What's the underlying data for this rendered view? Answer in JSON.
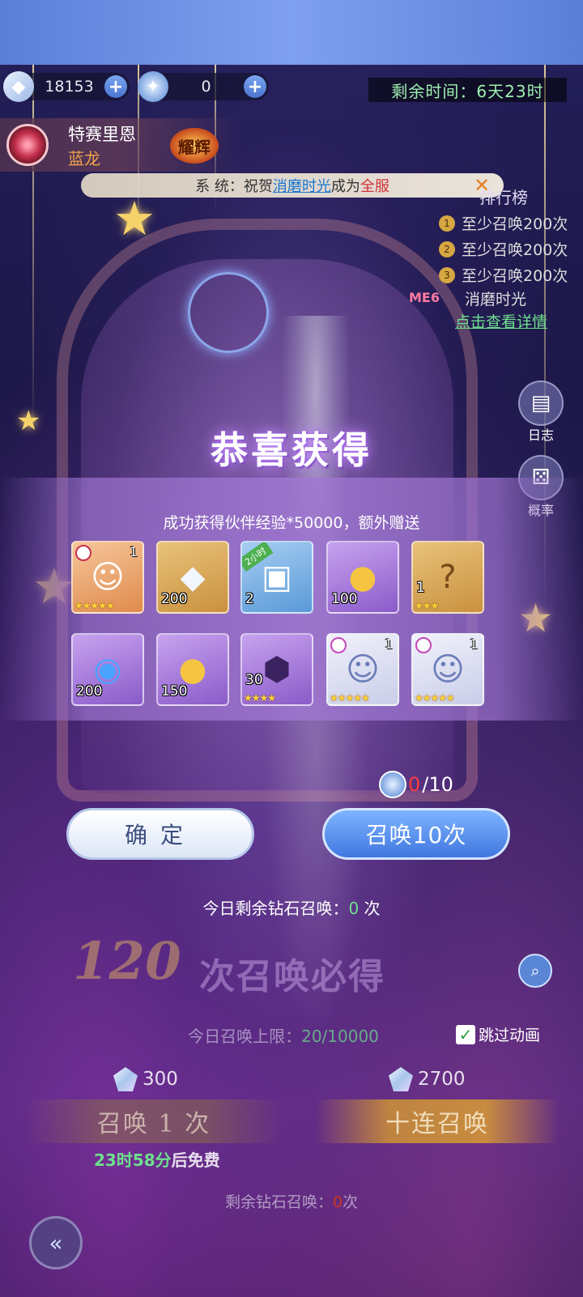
{
  "resources": [
    {
      "icon": "diamond-icon",
      "value": "18153"
    },
    {
      "icon": "summon-ticket-icon",
      "value": "0"
    }
  ],
  "timer": "剩余时间：6天23时",
  "banner": {
    "title": "特赛里恩",
    "subtitle": "蓝龙",
    "badge": "耀辉"
  },
  "system_message": {
    "prefix": "系 统：祝贺",
    "link": "消磨时光",
    "middle": "成为",
    "highlight": "全服"
  },
  "ranking": {
    "title": "排行榜",
    "items": [
      {
        "rank": "1",
        "text": "至少召唤200次"
      },
      {
        "rank": "2",
        "text": "至少召唤200次"
      },
      {
        "rank": "3",
        "text": "至少召唤200次"
      }
    ],
    "me_label": "ME6",
    "me_name": "消磨时光",
    "detail_link": "点击查看详情"
  },
  "side_buttons": [
    {
      "icon": "log-icon",
      "label": "日志"
    },
    {
      "icon": "dice-icon",
      "label": "概率"
    }
  ],
  "reward_popup": {
    "title": "恭喜获得",
    "subtitle": "成功获得伙伴经验*50000，额外赠送",
    "items_row1": [
      {
        "icon": "partner-portrait-icon",
        "count": "",
        "top": "1",
        "stars": "★★★★★",
        "rarity": "orange"
      },
      {
        "icon": "diamond-icon",
        "count": "200",
        "top": "",
        "stars": "",
        "rarity": "gold"
      },
      {
        "icon": "treasure-chest-icon",
        "count": "2",
        "top": "",
        "stars": "",
        "rarity": "blue",
        "tag": "2小时"
      },
      {
        "icon": "golden-egg-icon",
        "count": "100",
        "top": "",
        "stars": "",
        "rarity": "purple"
      },
      {
        "icon": "mystery-box-icon",
        "count": "1",
        "top": "",
        "stars": "★★★",
        "rarity": "gold"
      }
    ],
    "items_row2": [
      {
        "icon": "crystal-orb-icon",
        "count": "200",
        "top": "",
        "stars": "",
        "rarity": "purple"
      },
      {
        "icon": "golden-egg-icon",
        "count": "150",
        "top": "",
        "stars": "",
        "rarity": "purple"
      },
      {
        "icon": "shard-crystal-icon",
        "count": "30",
        "top": "",
        "stars": "★★★★",
        "rarity": "purple"
      },
      {
        "icon": "partner-portrait-icon",
        "count": "",
        "top": "1",
        "stars": "★★★★★",
        "rarity": "white"
      },
      {
        "icon": "partner-portrait-icon",
        "count": "",
        "top": "1",
        "stars": "★★★★★",
        "rarity": "white"
      }
    ],
    "ticket_current": "0",
    "ticket_total": "/10",
    "confirm_label": "确定",
    "summon10_label": "召唤10次",
    "daily_left_prefix": "今日剩余钻石召唤：",
    "daily_left_value": "0",
    "daily_left_suffix": " 次"
  },
  "background": {
    "guarantee_number": "120",
    "guarantee_text": "次召唤必得",
    "limit_prefix": "今日召唤上限：",
    "limit_value": "20/10000",
    "skip_label": "跳过动画",
    "cost_one": "300",
    "cost_ten": "2700",
    "summon_one_label": "召唤 1 次",
    "summon_ten_label": "十连召唤",
    "free_time": "23时58分",
    "free_suffix": "后免费",
    "remain_prefix": "剩余钻石召唤：",
    "remain_value": "0",
    "remain_suffix": "次"
  },
  "colors": {
    "accent_green": "#6de08d",
    "gold": "#f6d36a",
    "summon_blue": "#3f77e0"
  }
}
